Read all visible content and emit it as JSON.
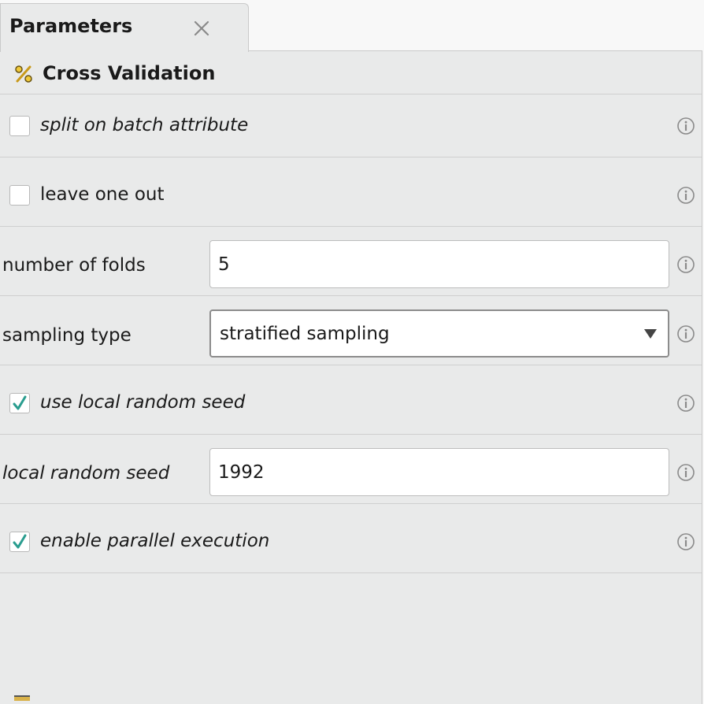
{
  "tab": {
    "title": "Parameters",
    "close_icon": "close-icon"
  },
  "operator": {
    "icon": "percent-icon",
    "title": "Cross Validation"
  },
  "parameters": {
    "split_on_batch_attribute": {
      "label": "split on batch attribute",
      "checked": false
    },
    "leave_one_out": {
      "label": "leave one out",
      "checked": false
    },
    "number_of_folds": {
      "label": "number of folds",
      "value": "5"
    },
    "sampling_type": {
      "label": "sampling type",
      "value": "stratified sampling"
    },
    "use_local_random_seed": {
      "label": "use local random seed",
      "checked": true
    },
    "local_random_seed": {
      "label": "local random seed",
      "value": "1992"
    },
    "enable_parallel_execution": {
      "label": "enable parallel execution",
      "checked": true
    }
  },
  "colors": {
    "check_mark": "#2a9d8f",
    "panel_background": "#e9eaea",
    "page_background": "#f8f8f8"
  }
}
